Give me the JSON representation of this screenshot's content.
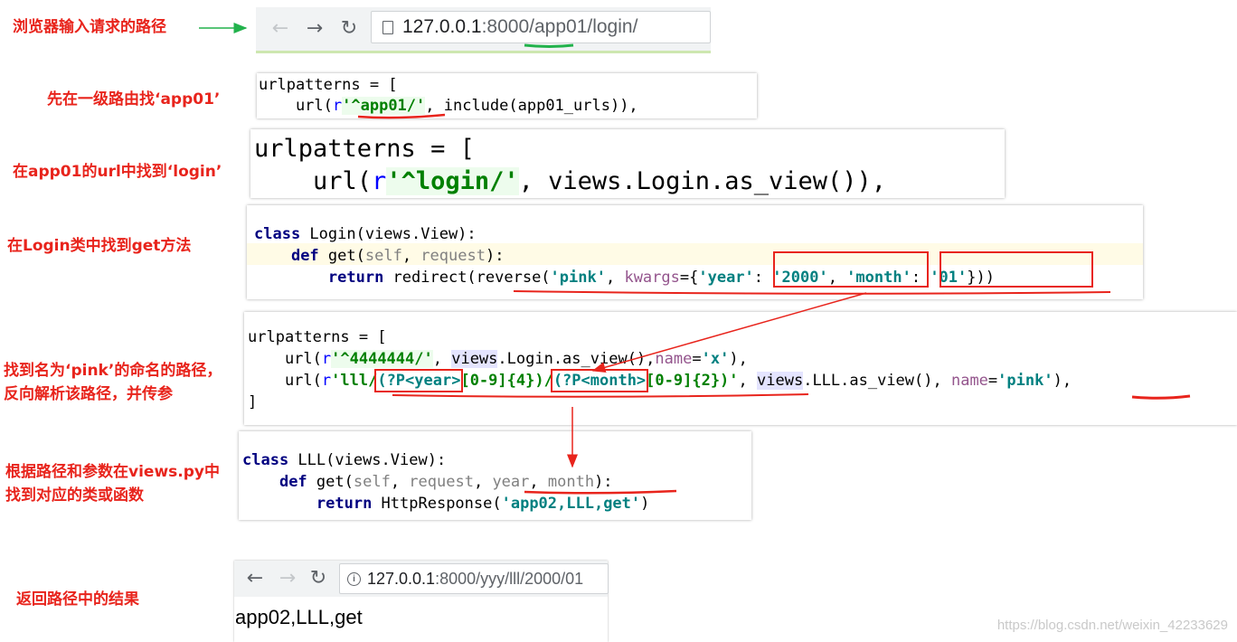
{
  "labels": {
    "step1": "浏览器输入请求的路径",
    "step2": "先在一级路由找‘app01’",
    "step3": "在app01的url中找到‘login’",
    "step4": "在Login类中找到get方法",
    "step5_line1": "找到名为‘pink’的命名的路径，",
    "step5_line2": "反向解析该路径，并传参",
    "step6_line1": "根据路径和参数在views.py中",
    "step6_line2": "找到对应的类或函数",
    "step7": "返回路径中的结果"
  },
  "browser_top": {
    "host": "127.0.0.1",
    "rest": ":8000/app01/login/",
    "back_icon": "arrow-left-icon",
    "forward_icon": "arrow-right-icon",
    "reload_icon": "reload-icon",
    "page_icon": "page-icon"
  },
  "code1": {
    "line1": "urlpatterns = [",
    "line2_a": "    url(",
    "line2_r": "r",
    "line2_str": "'^app01/'",
    "line2_b": ", include(app01_urls)),"
  },
  "code2": {
    "line1": "urlpatterns = [",
    "line2_a": "    url(",
    "line2_r": "r",
    "line2_str": "'^login/'",
    "line2_b": ", views.Login.as_view()),"
  },
  "code3": {
    "kw_class": "class",
    "l1_rest": " Login(views.View):",
    "kw_def": "def",
    "l2_a": " get(",
    "l2_self": "self",
    "l2_b": ", ",
    "l2_req": "request",
    "l2_c": "):",
    "kw_return": "return",
    "l3_a": " redirect(reverse(",
    "l3_pink": "'pink'",
    "l3_b": ", ",
    "l3_kwargs": "kwargs",
    "l3_c": "={",
    "l3_year": "'year'",
    "l3_d": ": ",
    "l3_2000": "'2000'",
    "l3_e": ", ",
    "l3_month": "'month'",
    "l3_f": ": ",
    "l3_01": "'01'",
    "l3_g": "}))"
  },
  "code4": {
    "line1": "urlpatterns = [",
    "l2_a": "    url(",
    "l2_r": "r",
    "l2_str": "'^4444444/'",
    "l2_b": ", ",
    "l2_views": "views",
    "l2_c": ".Login.as_view(),",
    "l2_name": "name",
    "l2_d": "=",
    "l2_x": "'x'",
    "l2_e": "),",
    "l3_a": "    url(",
    "l3_r": "r",
    "l3_s1": "'lll/",
    "l3_g1": "(?P<year>",
    "l3_s2": "[0-9]{4})/",
    "l3_g2": "(?P<month>",
    "l3_s3": "[0-9]{2})'",
    "l3_b": ", ",
    "l3_views": "views",
    "l3_c": ".LLL.as_view(), ",
    "l3_name": "name",
    "l3_d": "=",
    "l3_pink": "'pink'",
    "l3_e": "),",
    "line4": "]"
  },
  "code5": {
    "kw_class": "class",
    "l1_rest": " LLL(views.View):",
    "kw_def": "def",
    "l2_a": " get(",
    "l2_self": "self",
    "l2_b": ", ",
    "l2_req": "request",
    "l2_c": ", ",
    "l2_year": "year",
    "l2_d": ", ",
    "l2_month": "month",
    "l2_e": "):",
    "kw_return": "return",
    "l3_a": " HttpResponse(",
    "l3_str": "'app02,LLL,get'",
    "l3_b": ")"
  },
  "browser_bottom": {
    "host": "127.0.0.1",
    "rest": ":8000/yyy/lll/2000/01",
    "page_text": "app02,LLL,get",
    "back_icon": "arrow-left-icon",
    "forward_icon": "arrow-right-icon",
    "reload_icon": "reload-icon",
    "info_icon": "info-icon"
  },
  "watermark": "https://blog.csdn.net/weixin_42233629",
  "colors": {
    "annotation_red": "#e8241c",
    "green_underline": "#22b24c",
    "keyword": "#000080",
    "string": "#008080"
  }
}
